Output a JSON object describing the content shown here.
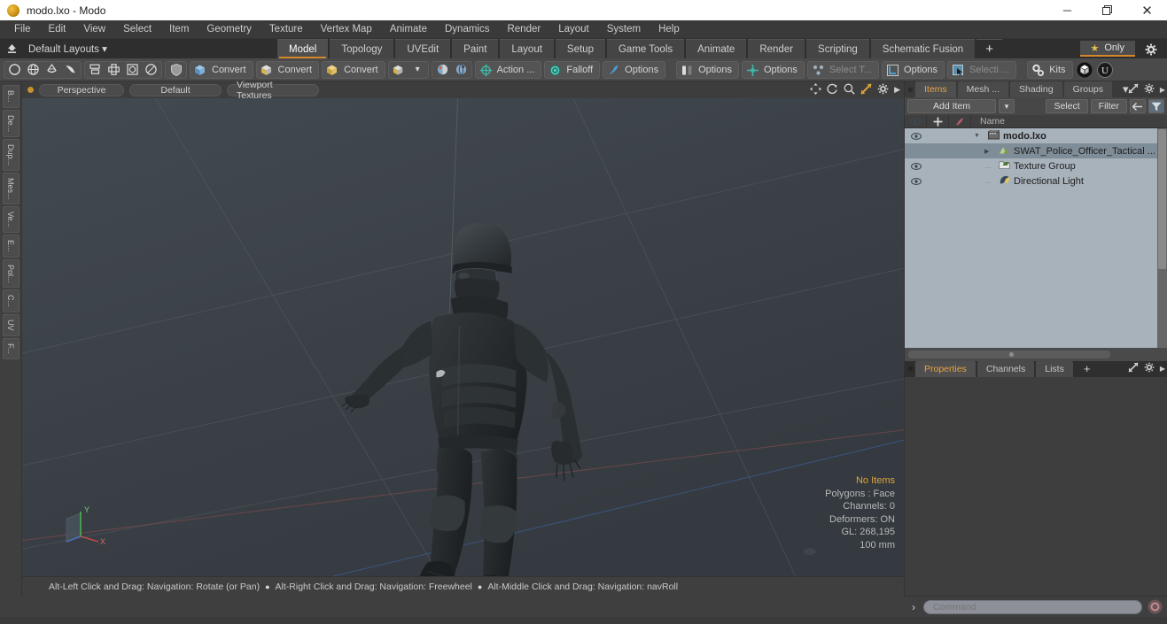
{
  "window": {
    "title": "modo.lxo - Modo",
    "app_icon": "modo-sphere-icon",
    "controls": {
      "minimize": "─",
      "maximize": "❐",
      "close": "✕"
    }
  },
  "menubar": {
    "items": [
      "File",
      "Edit",
      "View",
      "Select",
      "Item",
      "Geometry",
      "Texture",
      "Vertex Map",
      "Animate",
      "Dynamics",
      "Render",
      "Layout",
      "System",
      "Help"
    ]
  },
  "layoutbar": {
    "home_icon": "home-up-icon",
    "layout_label": "Default Layouts ▾",
    "tabs": [
      {
        "label": "Model",
        "active": true
      },
      {
        "label": "Topology",
        "active": false
      },
      {
        "label": "UVEdit",
        "active": false
      },
      {
        "label": "Paint",
        "active": false
      },
      {
        "label": "Layout",
        "active": false
      },
      {
        "label": "Setup",
        "active": false
      },
      {
        "label": "Game Tools",
        "active": false
      },
      {
        "label": "Animate",
        "active": false
      },
      {
        "label": "Render",
        "active": false
      },
      {
        "label": "Scripting",
        "active": false
      },
      {
        "label": "Schematic Fusion",
        "active": false
      }
    ],
    "add_tab_label": "+",
    "only_button": {
      "label": "Only",
      "star_icon": "star-icon"
    },
    "gear_icon": "gear-icon"
  },
  "toolbar": {
    "primitive_group": [
      "circle-icon",
      "sphere-icon",
      "cone-icon",
      "pen-icon"
    ],
    "mesh_group": [
      "mesh-stack-icon",
      "mesh-cross-icon",
      "mesh-square-icon",
      "mesh-oval-icon"
    ],
    "shield_icon": "shield-icon",
    "converts": [
      {
        "label": "Convert",
        "icon": "convert-blue-icon"
      },
      {
        "label": "Convert",
        "icon": "convert-yellow-icon"
      },
      {
        "label": "Convert",
        "icon": "convert-gold-icon"
      }
    ],
    "cube_dropdown": {
      "icon": "cube-icon",
      "arrow": "▾"
    },
    "paint_icons": [
      "paint-ball-icon",
      "paint-sphere-icon"
    ],
    "action_button": {
      "label": "Action  ...",
      "icon": "action-center-icon"
    },
    "falloff_button": {
      "label": "Falloff",
      "icon": "falloff-icon"
    },
    "options_1": {
      "label": "Options",
      "icon": "tool-options-icon"
    },
    "options_2": {
      "label": "Options",
      "icon": "symmetry-icon"
    },
    "options_3": {
      "label": "Options",
      "icon": "snap-icon"
    },
    "select_through": {
      "label": "Select T...",
      "icon": "select-through-icon",
      "dim": true
    },
    "options_4": {
      "label": "Options",
      "icon": "workplane-icon"
    },
    "selection_sets": {
      "label": "Selecti ...",
      "icon": "selection-icon"
    },
    "kits": {
      "label": "Kits",
      "icon": "kits-icon"
    },
    "unity_icon": "unity-export-icon",
    "unreal_icon": "unreal-export-icon"
  },
  "left_tabs": [
    "B...",
    "De...",
    "Dup...",
    "Mes...",
    "Ve...",
    "E...",
    "Pol...",
    "C...",
    "UV",
    "F..."
  ],
  "viewport": {
    "dot_icon": "viewport-state-dot",
    "mode_button": "Perspective",
    "preset_button": "Default",
    "shading_button": "Viewport Textures",
    "header_icons": [
      "pan-icon",
      "rotate-icon",
      "zoom-icon",
      "fit-icon",
      "viewport-gear-icon",
      "viewport-arrow-icon"
    ],
    "stats": {
      "items": "No Items",
      "polygons": "Polygons : Face",
      "channels": "Channels: 0",
      "deformers": "Deformers: ON",
      "gl": "GL: 268,195",
      "scale": "100 mm"
    },
    "gizmo_axes": {
      "y": "Y",
      "x": "X"
    },
    "model_description": "SWAT police officer tactical character, dark body armor, helmet and goggles, posed standing"
  },
  "statusbar": {
    "hint_1": "Alt-Left Click and Drag: Navigation: Rotate (or Pan)",
    "hint_2": "Alt-Right Click and Drag: Navigation: Freewheel",
    "hint_3": "Alt-Middle Click and Drag: Navigation: navRoll",
    "separator": "●"
  },
  "right_panel": {
    "tabs": [
      {
        "label": "Items",
        "active": true
      },
      {
        "label": "Mesh ...",
        "active": false
      },
      {
        "label": "Shading",
        "active": false
      },
      {
        "label": "Groups",
        "active": false
      }
    ],
    "tab_overflow": "▾",
    "expand_icon": "expand-icon",
    "gear_icon": "gear-icon",
    "arrow_icon": "chevron-right-icon",
    "toolrow": {
      "add_item": "Add Item",
      "add_item_arrow": "▾",
      "select": "Select",
      "filter": "Filter",
      "back_icon": "back-arrow-icon",
      "funnel_icon": "funnel-icon"
    },
    "list_header": {
      "eye_icon": "eye-icon",
      "lock_icon": "move-lock-icon",
      "render_icon": "render-flag-icon",
      "name": "Name"
    },
    "items": [
      {
        "name": "modo.lxo",
        "icon": "scene-icon",
        "depth": 0,
        "eye": true,
        "expander": "▼",
        "selected": false,
        "bold": true
      },
      {
        "name": "SWAT_Police_Officer_Tactical ...",
        "icon": "mesh-item-icon",
        "depth": 1,
        "eye": false,
        "expander": "▶",
        "selected": true,
        "bold": false
      },
      {
        "name": "Texture Group",
        "icon": "texture-group-icon",
        "depth": 1,
        "eye": true,
        "expander": "",
        "selected": false,
        "bold": false
      },
      {
        "name": "Directional Light",
        "icon": "light-icon",
        "depth": 1,
        "eye": true,
        "expander": "",
        "selected": false,
        "bold": false
      }
    ]
  },
  "properties_panel": {
    "tabs": [
      {
        "label": "Properties",
        "active": true
      },
      {
        "label": "Channels",
        "active": false
      },
      {
        "label": "Lists",
        "active": false
      }
    ],
    "add_tab": "+",
    "expand_icon": "expand-icon",
    "gear_icon": "gear-icon",
    "arrow_icon": "chevron-right-icon"
  },
  "command_bar": {
    "prompt": "›",
    "placeholder": "Command",
    "value": "",
    "record_icon": "record-icon"
  },
  "colors": {
    "accent_orange": "#d4882a",
    "tab_text_active": "#e8a33d",
    "panel_bg": "#3a3a3a",
    "toolbar_bg": "#4a4a4a",
    "list_bg": "#a8b2bb",
    "list_selected": "#7f8d98",
    "viewport_bg": "#3c4247"
  }
}
